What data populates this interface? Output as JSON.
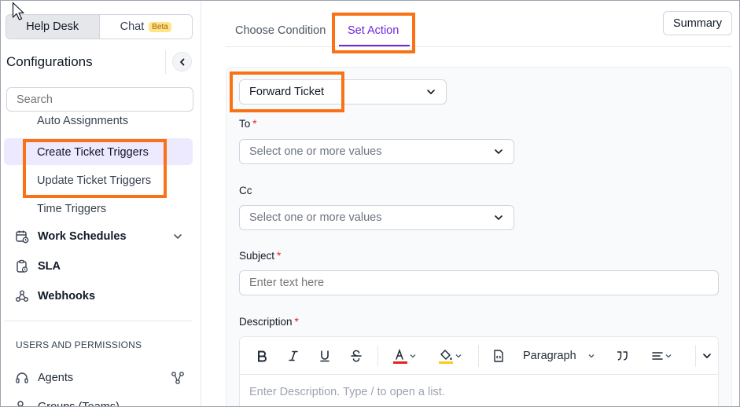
{
  "sidebar": {
    "segment": {
      "helpdesk": "Help Desk",
      "chat": "Chat",
      "chat_badge": "Beta"
    },
    "title": "Configurations",
    "search_placeholder": "Search",
    "sub_items": {
      "auto_assign": "Auto Assignments",
      "create_triggers": "Create Ticket Triggers",
      "update_triggers": "Update Ticket Triggers",
      "time_triggers": "Time Triggers"
    },
    "nav": {
      "work_schedules": "Work Schedules",
      "sla": "SLA",
      "webhooks": "Webhooks"
    },
    "section_users": "USERS AND PERMISSIONS",
    "agents": "Agents",
    "groups": "Groups (Teams)"
  },
  "tabs": {
    "choose": "Choose Condition",
    "set": "Set Action"
  },
  "summary": "Summary",
  "form": {
    "action_value": "Forward Ticket",
    "to_label": "To",
    "to_placeholder": "Select one or more values",
    "cc_label": "Cc",
    "cc_placeholder": "Select one or more values",
    "subject_label": "Subject",
    "subject_placeholder": "Enter text here",
    "description_label": "Description",
    "paragraph": "Paragraph",
    "description_placeholder": "Enter Description. Type / to open a list."
  },
  "colors": {
    "accent": "#6d28d9",
    "highlight": "#f97316",
    "active_bg": "#ede9fe",
    "required": "#dc2626"
  }
}
